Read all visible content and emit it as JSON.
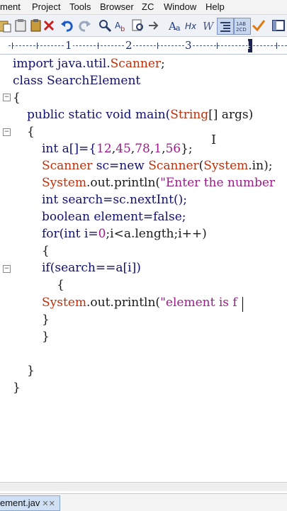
{
  "menubar": {
    "items": [
      "ment",
      "Project",
      "Tools",
      "Browser",
      "ZC",
      "Window",
      "Help"
    ]
  },
  "toolbar": {
    "icons": [
      "paste-icon",
      "clipboard-icon",
      "delete-icon",
      "undo-icon",
      "redo-icon",
      "find-icon",
      "replace-icon",
      "find-in-files-icon",
      "goto-icon",
      "font-case-icon",
      "hex-icon",
      "word-wrap-icon",
      "indent-icon",
      "column-mode-icon",
      "spell-check-icon",
      "panel-icon"
    ],
    "labels": {
      "hex": "Hx",
      "column": "1AB\n2CD"
    }
  },
  "ruler": {
    "labels": [
      "1",
      "2",
      "3",
      "4"
    ]
  },
  "code": {
    "l1": [
      "import java.util.",
      "Scanner",
      ";"
    ],
    "l2": [
      "class SearchElement"
    ],
    "l3": [
      "{"
    ],
    "l4": [
      "public static void main(",
      "String",
      "[] args)"
    ],
    "l5": [
      "{"
    ],
    "l6": [
      "int a[]={",
      "12",
      ",",
      "45",
      ",",
      "78",
      ",",
      "1",
      ",",
      "56",
      "};"
    ],
    "l7": [
      "Scanner",
      " sc=new ",
      "Scanner",
      "(",
      "System",
      ".in);"
    ],
    "l8": [
      "System",
      ".out.println(",
      "\"Enter the number "
    ],
    "l9": [
      "int search=sc.nextInt();"
    ],
    "l10": [
      "boolean element=false;"
    ],
    "l11": [
      "for(int i=",
      "0",
      ";i<a.length;i++)"
    ],
    "l12": [
      "{"
    ],
    "l13": [
      "if(search==a[i])"
    ],
    "l14": [
      "{"
    ],
    "l15": [
      "System",
      ".out.println(",
      "\"element is f"
    ],
    "l16": [
      "}"
    ],
    "l17": [
      "}"
    ],
    "l18": [
      "}"
    ],
    "l19": [
      "}"
    ]
  },
  "tabs": {
    "file": "ement.jav",
    "close": "✕✕"
  },
  "colors": {
    "keyword": "#10106e",
    "class": "#c0300a",
    "string": "#a01a8a",
    "tab_active": "#cfe0f4"
  }
}
